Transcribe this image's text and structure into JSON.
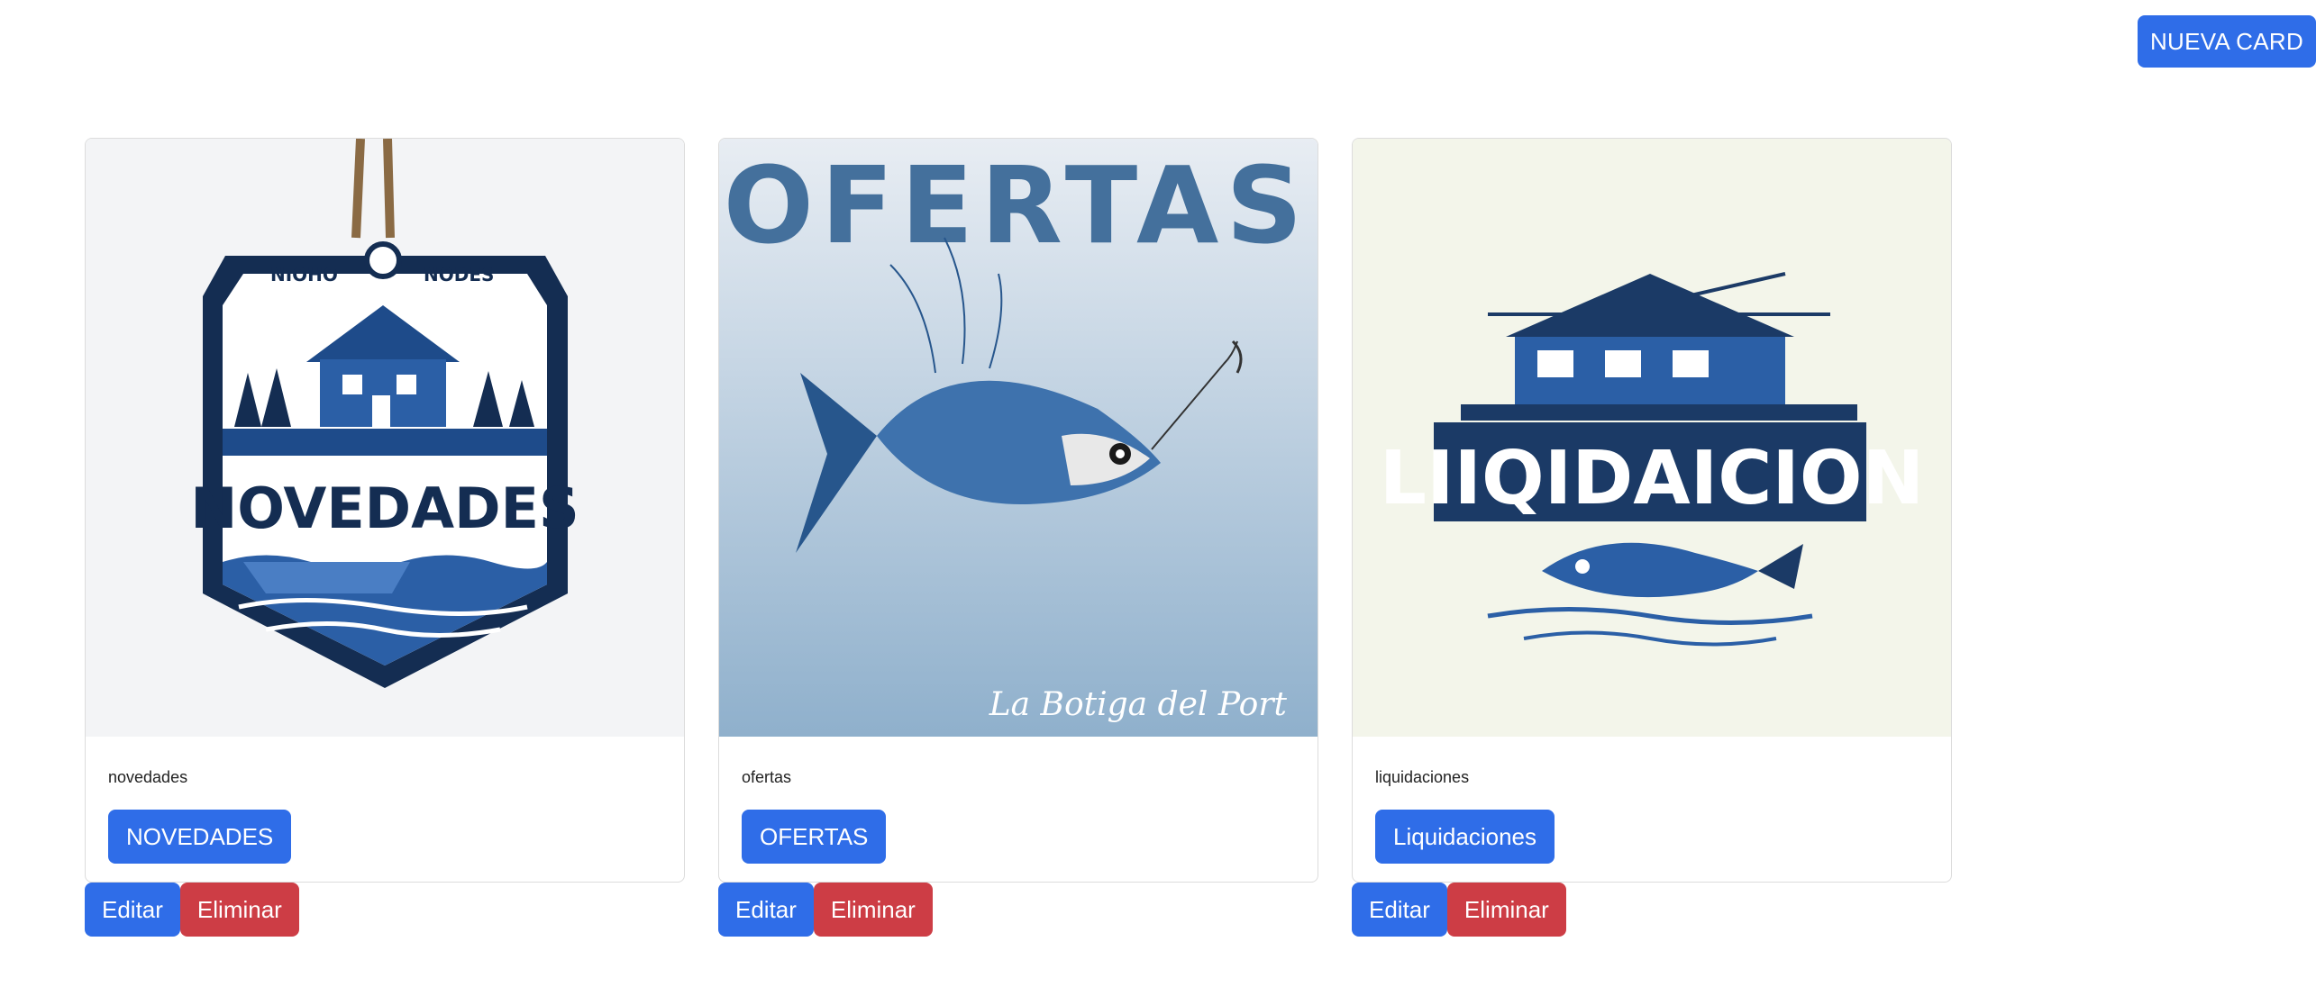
{
  "toolbar": {
    "new_card_label": "NUEVA CARD"
  },
  "colors": {
    "primary": "#2f6de8",
    "danger": "#cd3d45",
    "navy": "#1b3a66"
  },
  "cards": [
    {
      "image_text": "NOVEDADES",
      "image_subtext_left": "NIOHO",
      "image_subtext_right": "NODES",
      "caption": "novedades",
      "button_label": "NOVEDADES",
      "edit_label": "Editar",
      "delete_label": "Eliminar"
    },
    {
      "image_text": "OFERTAS",
      "image_signature": "La Botiga del Port",
      "caption": "ofertas",
      "button_label": "OFERTAS",
      "edit_label": "Editar",
      "delete_label": "Eliminar"
    },
    {
      "image_text": "LIIQIDAICION",
      "caption": "liquidaciones",
      "button_label": "Liquidaciones",
      "edit_label": "Editar",
      "delete_label": "Eliminar"
    }
  ]
}
